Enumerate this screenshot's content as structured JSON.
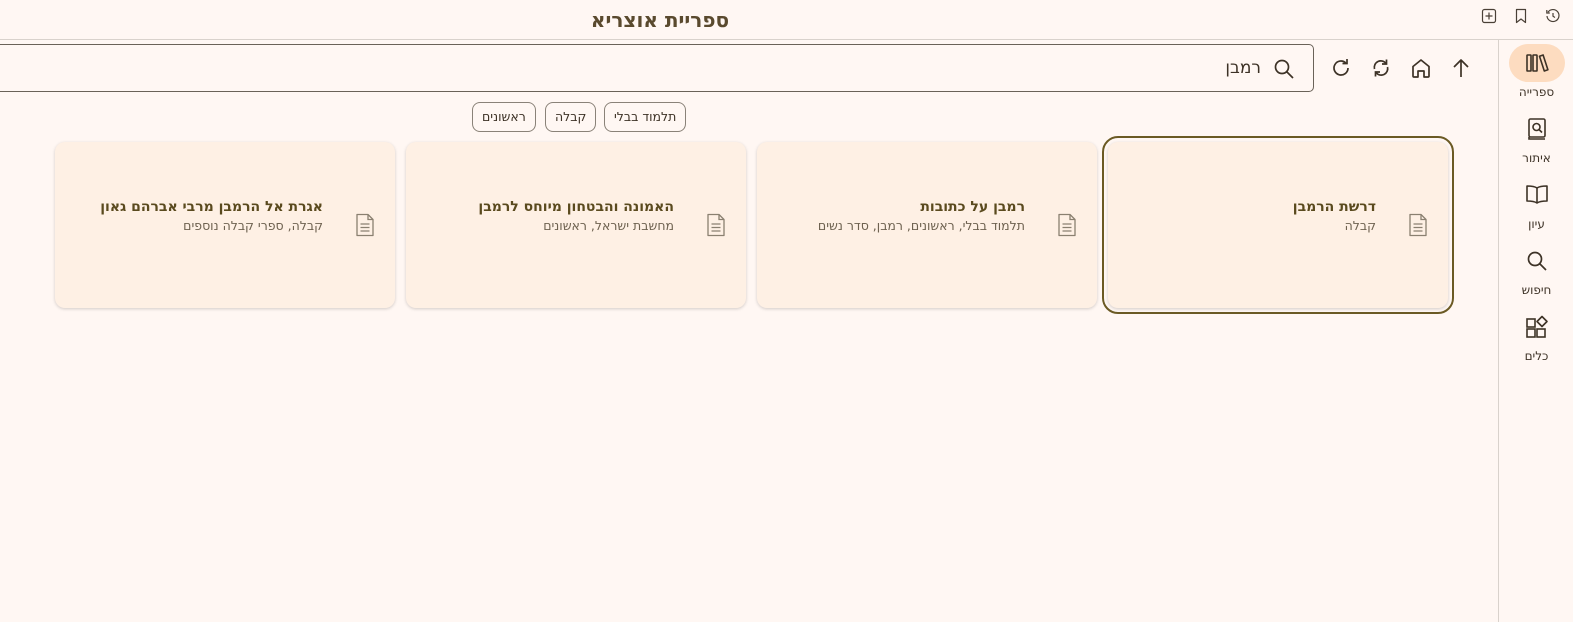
{
  "app": {
    "title": "ספריית אוצריא"
  },
  "titlebar_buttons": [
    {
      "name": "add-tab-icon"
    },
    {
      "name": "bookmark-icon"
    },
    {
      "name": "history-icon"
    }
  ],
  "sidebar": {
    "items": [
      {
        "label": "ספרייה",
        "icon": "library-icon",
        "active": true
      },
      {
        "label": "איתור",
        "icon": "find-book-icon",
        "active": false
      },
      {
        "label": "עיון",
        "icon": "open-book-icon",
        "active": false
      },
      {
        "label": "חיפוש",
        "icon": "search-icon",
        "active": false
      },
      {
        "label": "כלים",
        "icon": "tools-icon",
        "active": false
      }
    ]
  },
  "toolbar": {
    "buttons": [
      "up-arrow-icon",
      "home-icon",
      "sync-icon",
      "refresh-icon"
    ],
    "search_value": "רמבן"
  },
  "filters": [
    "תלמוד בבלי",
    "קבלה",
    "ראשונים"
  ],
  "results": [
    {
      "title": "דרשת הרמבן",
      "categories": "קבלה",
      "selected": true
    },
    {
      "title": "רמבן על כתובות",
      "categories": "תלמוד בבלי, ראשונים, רמבן, סדר נשים",
      "selected": false
    },
    {
      "title": "האמונה והבטחון מיוחס לרמבן",
      "categories": "מחשבת ישראל, ראשונים",
      "selected": false
    },
    {
      "title": "אגרת אל הרמבן מרבי אברהם גאון",
      "categories": "קבלה, ספרי קבלה נוספים",
      "selected": false
    }
  ],
  "colors": {
    "background": "#fff7f3",
    "card": "#fef0e4",
    "accent": "#fddcc0",
    "title_brown": "#5a4a2e",
    "selected_outline": "#6b5a24"
  }
}
